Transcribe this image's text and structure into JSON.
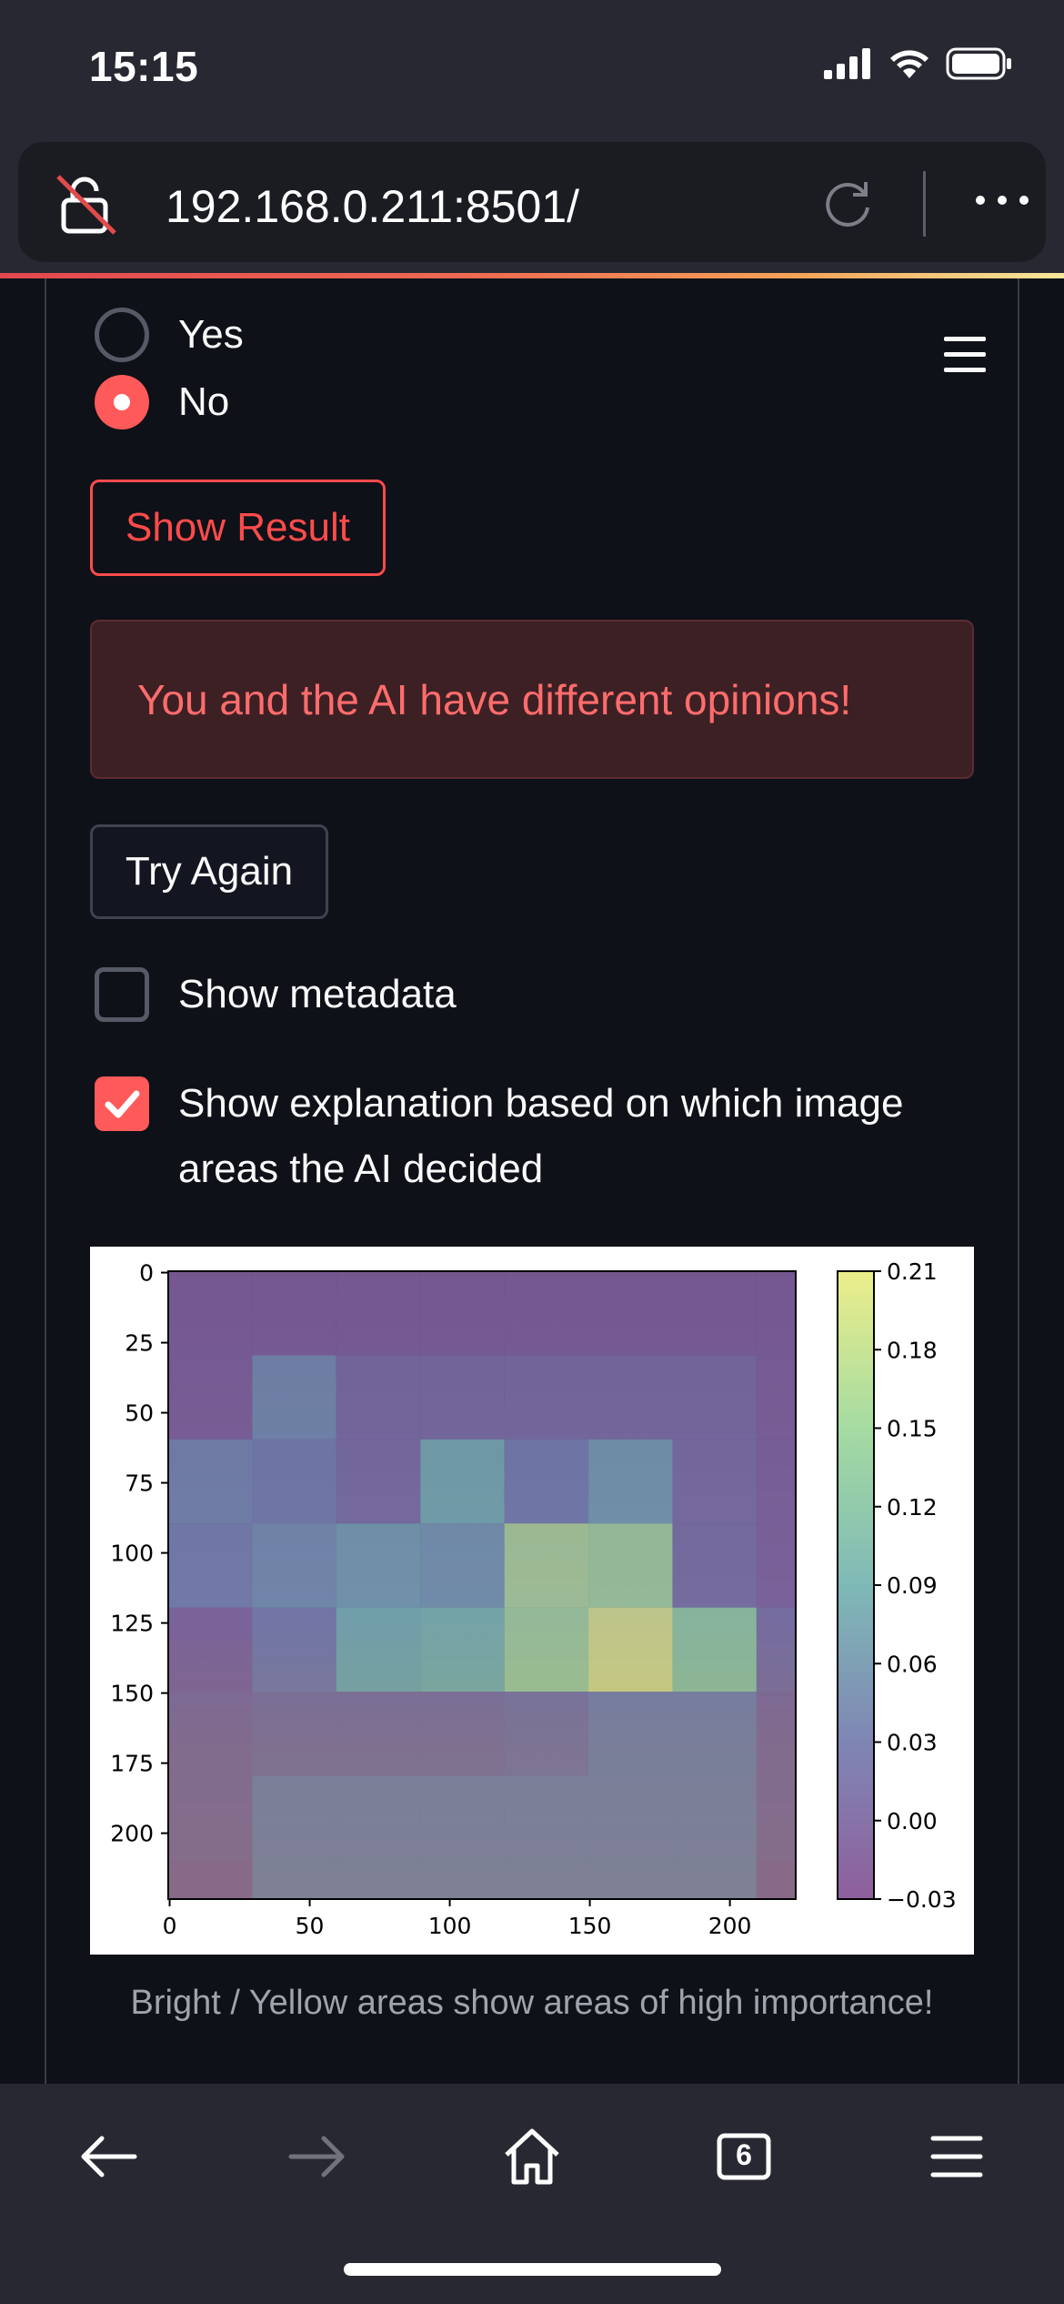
{
  "status_bar": {
    "time": "15:15"
  },
  "browser": {
    "url": "192.168.0.211:8501/",
    "tab_count": "6"
  },
  "radio_group": {
    "options": [
      {
        "label": "Yes",
        "checked": false
      },
      {
        "label": "No",
        "checked": true
      }
    ]
  },
  "buttons": {
    "show_result": "Show Result",
    "try_again": "Try Again"
  },
  "alert": {
    "message": "You and the AI have different opinions!"
  },
  "checkboxes": {
    "show_metadata": {
      "label": "Show metadata",
      "checked": false
    },
    "show_explanation": {
      "label": "Show explanation based on which image areas the AI decided",
      "checked": true
    }
  },
  "heatmap_caption": "Bright / Yellow areas show areas of high importance!",
  "colors": {
    "accent": "#ff4b4b",
    "background": "#0e1117",
    "alert_bg": "#3d2024",
    "alert_text": "#ff6c6c"
  },
  "chart_data": {
    "type": "heatmap",
    "xticks": [
      "0",
      "50",
      "100",
      "150",
      "200"
    ],
    "yticks": [
      "0",
      "25",
      "50",
      "75",
      "100",
      "125",
      "150",
      "175",
      "200"
    ],
    "xlim": [
      0,
      224
    ],
    "ylim": [
      224,
      0
    ],
    "cell_size": 30,
    "values": [
      [
        -0.02,
        -0.02,
        -0.02,
        -0.02,
        -0.02,
        -0.02,
        -0.02,
        -0.02
      ],
      [
        -0.02,
        0.05,
        0.0,
        0.0,
        0.0,
        0.0,
        0.0,
        -0.02
      ],
      [
        0.04,
        0.03,
        0.0,
        0.09,
        0.03,
        0.07,
        0.0,
        -0.02
      ],
      [
        0.03,
        0.05,
        0.07,
        0.06,
        0.17,
        0.16,
        0.0,
        -0.02
      ],
      [
        -0.02,
        0.02,
        0.09,
        0.1,
        0.16,
        0.21,
        0.14,
        0.0
      ],
      [
        -0.01,
        0.0,
        0.0,
        0.0,
        0.01,
        0.03,
        0.03,
        -0.01
      ],
      [
        -0.01,
        0.03,
        0.03,
        0.03,
        0.03,
        0.03,
        0.03,
        -0.01
      ],
      [
        -0.02,
        0.03,
        0.03,
        0.03,
        0.03,
        0.03,
        0.03,
        -0.02
      ]
    ],
    "colorbar": {
      "range": [
        -0.03,
        0.21
      ],
      "ticks": [
        "0.21",
        "0.18",
        "0.15",
        "0.12",
        "0.09",
        "0.06",
        "0.03",
        "0.00",
        "−0.03"
      ]
    }
  }
}
